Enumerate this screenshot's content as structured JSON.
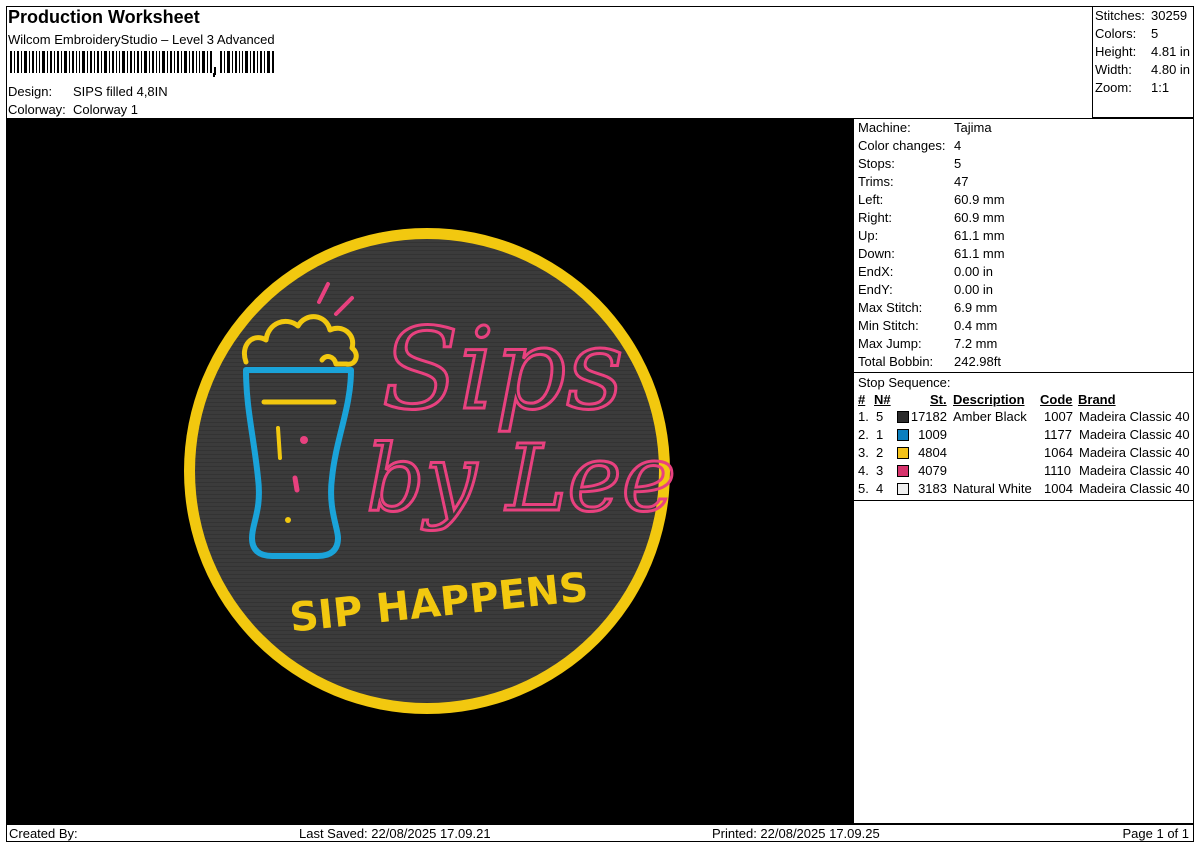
{
  "header": {
    "title": "Production Worksheet",
    "software": "Wilcom EmbroideryStudio – Level 3 Advanced",
    "design_label": "Design:",
    "design_value": "SIPS filled 4,8IN",
    "colorway_label": "Colorway:",
    "colorway_value": "Colorway 1"
  },
  "stats": [
    {
      "label": "Stitches:",
      "value": "30259"
    },
    {
      "label": "Colors:",
      "value": "5"
    },
    {
      "label": "Height:",
      "value": "4.81 in"
    },
    {
      "label": "Width:",
      "value": "4.80 in"
    },
    {
      "label": "Zoom:",
      "value": "1:1"
    }
  ],
  "machine_info": [
    {
      "label": "Machine:",
      "value": "Tajima"
    },
    {
      "label": "Color changes:",
      "value": "4"
    },
    {
      "label": "Stops:",
      "value": "5"
    },
    {
      "label": "Trims:",
      "value": "47"
    },
    {
      "label": "Left:",
      "value": "60.9 mm"
    },
    {
      "label": "Right:",
      "value": "60.9 mm"
    },
    {
      "label": "Up:",
      "value": "61.1 mm"
    },
    {
      "label": "Down:",
      "value": "61.1 mm"
    },
    {
      "label": "EndX:",
      "value": "0.00 in"
    },
    {
      "label": "EndY:",
      "value": "0.00 in"
    },
    {
      "label": "Max Stitch:",
      "value": "6.9 mm"
    },
    {
      "label": "Min Stitch:",
      "value": "0.4 mm"
    },
    {
      "label": "Max Jump:",
      "value": "7.2 mm"
    },
    {
      "label": "Total Bobbin:",
      "value": "242.98ft"
    }
  ],
  "stop_sequence": {
    "title": "Stop Sequence:",
    "columns": [
      "#",
      "N#",
      "St.",
      "Description",
      "Code",
      "Brand"
    ],
    "rows": [
      {
        "idx": "1.",
        "n": "5",
        "color": "#2b2b2b",
        "st": "17182",
        "desc": "Amber Black",
        "code": "1007",
        "brand": "Madeira Classic 40"
      },
      {
        "idx": "2.",
        "n": "1",
        "color": "#0b7fbf",
        "st": "1009",
        "desc": "",
        "code": "1177",
        "brand": "Madeira Classic 40"
      },
      {
        "idx": "3.",
        "n": "2",
        "color": "#f4c21a",
        "st": "4804",
        "desc": "",
        "code": "1064",
        "brand": "Madeira Classic 40"
      },
      {
        "idx": "4.",
        "n": "3",
        "color": "#d6336c",
        "st": "4079",
        "desc": "",
        "code": "1110",
        "brand": "Madeira Classic 40"
      },
      {
        "idx": "5.",
        "n": "4",
        "color": "#efefef",
        "st": "3183",
        "desc": "Natural White",
        "code": "1004",
        "brand": "Madeira Classic 40"
      }
    ]
  },
  "design_art": {
    "line1": "Sips",
    "line2": "by Lee",
    "tagline": "SIP HAPPENS",
    "colors": {
      "border": "#f2c80f",
      "fill": "#3a3a3a",
      "blue": "#1aa3d9",
      "pink": "#e8417f",
      "white": "#f4eaea"
    }
  },
  "footer": {
    "created_by": "Created By:",
    "last_saved": "Last Saved: 22/08/2025 17.09.21",
    "printed": "Printed: 22/08/2025 17.09.25",
    "page": "Page 1 of 1"
  }
}
